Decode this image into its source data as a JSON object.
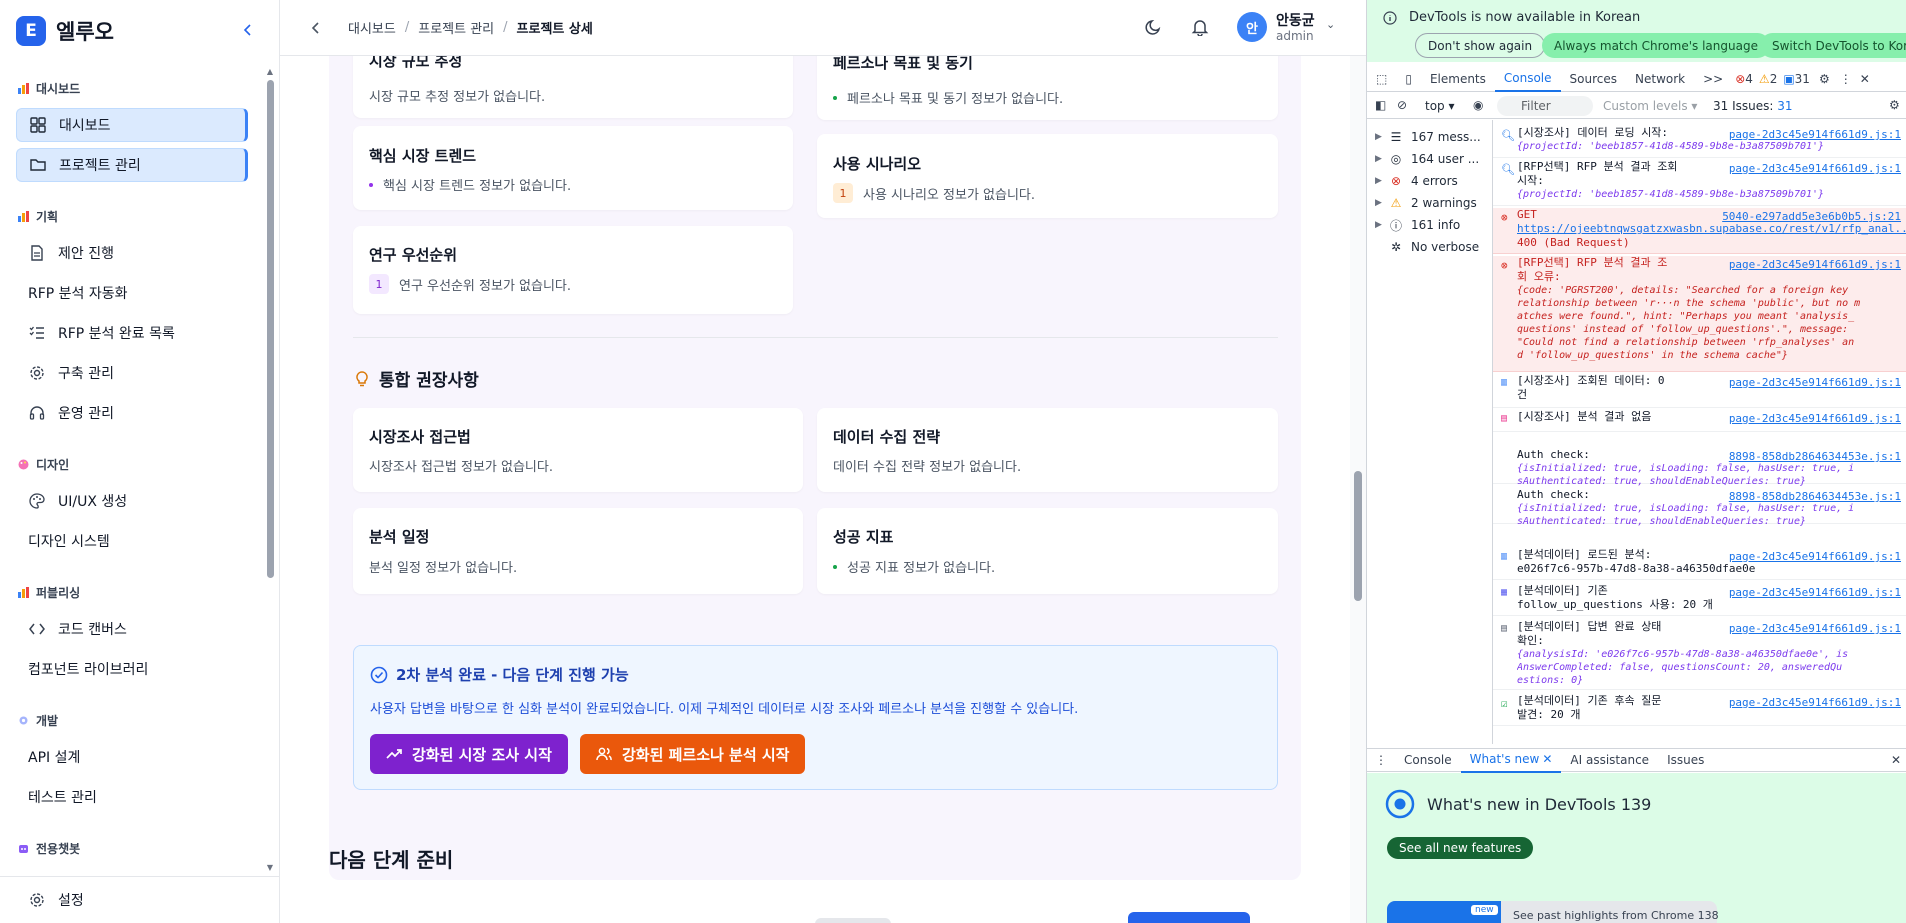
{
  "sidebar": {
    "logo_letter": "E",
    "app_name": "엘루오",
    "sections": [
      {
        "label": "대시보드"
      },
      {
        "label": "기획"
      },
      {
        "label": "디자인"
      },
      {
        "label": "퍼블리싱"
      },
      {
        "label": "개발"
      },
      {
        "label": "전용챗봇"
      }
    ],
    "items": [
      {
        "label": "대시보드",
        "icon": "grid-icon"
      },
      {
        "label": "프로젝트 관리",
        "icon": "folder-icon"
      },
      {
        "label": "제안 진행",
        "icon": "document-icon"
      },
      {
        "label": "RFP 분석 자동화",
        "icon": ""
      },
      {
        "label": "RFP 분석 완료 목록",
        "icon": "list-check-icon"
      },
      {
        "label": "구축 관리",
        "icon": "gear-icon"
      },
      {
        "label": "운영 관리",
        "icon": "headset-icon"
      },
      {
        "label": "UI/UX 생성",
        "icon": "palette-icon"
      },
      {
        "label": "디자인 시스템",
        "icon": ""
      },
      {
        "label": "코드 캔버스",
        "icon": "code-icon"
      },
      {
        "label": "컴포넌트 라이브러리",
        "icon": ""
      },
      {
        "label": "API 설계",
        "icon": ""
      },
      {
        "label": "테스트 관리",
        "icon": ""
      }
    ],
    "settings_label": "설정"
  },
  "header": {
    "breadcrumb": [
      "대시보드",
      "프로젝트 관리",
      "프로젝트 상세"
    ],
    "user_initial": "안",
    "user_name": "안동균",
    "user_role": "admin"
  },
  "cards": {
    "market_size": {
      "title": "시장 규모 추정",
      "body": "시장 규모 추정 정보가 없습니다."
    },
    "persona_goal": {
      "title": "페르소나 목표 및 동기",
      "body": "페르소나 목표 및 동기 정보가 없습니다."
    },
    "trend": {
      "title": "핵심 시장 트렌드",
      "body": "핵심 시장 트렌드 정보가 없습니다."
    },
    "scenario": {
      "title": "사용 시나리오",
      "number": "1",
      "body": "사용 시나리오 정보가 없습니다."
    },
    "priority": {
      "title": "연구 우선순위",
      "number": "1",
      "body": "연구 우선순위 정보가 없습니다."
    }
  },
  "recommend": {
    "title": "통합 권장사항",
    "approach": {
      "title": "시장조사 접근법",
      "body": "시장조사 접근법 정보가 없습니다."
    },
    "data_strategy": {
      "title": "데이터 수집 전략",
      "body": "데이터 수집 전략 정보가 없습니다."
    },
    "schedule": {
      "title": "분석 일정",
      "body": "분석 일정 정보가 없습니다."
    },
    "success": {
      "title": "성공 지표",
      "body": "성공 지표 정보가 없습니다."
    }
  },
  "completion": {
    "title": "2차 분석 완료 - 다음 단계 진행 가능",
    "description": "사용자 답변을 바탕으로 한 심화 분석이 완료되었습니다. 이제 구체적인 데이터로 시장 조사와 페르소나 분석을 진행할 수 있습니다.",
    "market_button": "강화된 시장 조사 시작",
    "persona_button": "강화된 페르소나 분석 시작",
    "market_color": "#7e22ce",
    "persona_color": "#ea580c"
  },
  "next_section_title": "다음 단계 준비",
  "devtools": {
    "notice": "DevTools is now available in Korean",
    "btn_dont_show": "Don't show again",
    "btn_match": "Always match Chrome's language",
    "btn_switch": "Switch DevTools to Korea",
    "tabs": [
      "Elements",
      "Console",
      "Sources",
      "Network"
    ],
    "more_tabs": ">>",
    "error_count": "4",
    "warning_count": "2",
    "issue_count": "31",
    "context": "top",
    "filter_placeholder": "Filter",
    "levels": "Custom levels",
    "issues_label": "31 Issues:",
    "issues_badge": "31",
    "side": [
      {
        "label": "167 mess..."
      },
      {
        "label": "164 user ..."
      },
      {
        "label": "4 errors"
      },
      {
        "label": "2 warnings"
      },
      {
        "label": "161 info"
      },
      {
        "label": "No verbose"
      }
    ],
    "logs": [
      {
        "text": "[시장조사] 데이터 로딩 시작:",
        "src": "page-2d3c45e914f661d9.js:1",
        "obj": "{projectId: 'beeb1857-41d8-4589-9b8e-b3a87509b701'}"
      },
      {
        "text": "[RFP선택] RFP 분석 결과 조회",
        "text2": "시작:",
        "src": "page-2d3c45e914f661d9.js:1",
        "obj": "{projectId: 'beeb1857-41d8-4589-9b8e-b3a87509b701'}"
      },
      {
        "text": "GET",
        "src": "5040-e297add5e3e6b0b5.js:21",
        "text2": "https://ojeebtnqwsgatzxwasbn.supabase.co/rest/v1/rfp_anal...",
        "text3": "400 (Bad Request)"
      },
      {
        "text": "[RFP선택] RFP 분석 결과 조",
        "text2": "회 오류:",
        "src": "page-2d3c45e914f661d9.js:1",
        "obj": "{code: 'PGRST200', details: \"Searched for a foreign key",
        "obj2": "relationship between 'r···n the schema 'public', but no m",
        "obj3": "atches were found.\", hint: \"Perhaps you meant 'analysis_",
        "obj4": "questions' instead of 'follow_up_questions'.\", message:",
        "obj5": "\"Could not find a relationship between 'rfp_analyses' an",
        "obj6": "d 'follow_up_questions' in the schema cache\"}"
      },
      {
        "text": "[시장조사] 조회된 데이터: 0",
        "text2": "건",
        "src": "page-2d3c45e914f661d9.js:1"
      },
      {
        "text": "[시장조사] 분석 결과 없음",
        "src": "page-2d3c45e914f661d9.js:1"
      },
      {
        "text": "Auth check:",
        "src": "8898-858db2864634453e.js:1",
        "obj": "{isInitialized: true, isLoading: false, hasUser: true, i",
        "obj2": "sAuthenticated: true, shouldEnableQueries: true}"
      },
      {
        "text": "Auth check:",
        "src": "8898-858db2864634453e.js:1",
        "obj": "{isInitialized: true, isLoading: false, hasUser: true, i",
        "obj2": "sAuthenticated: true, shouldEnableQueries: true}"
      },
      {
        "text": "[분석데이터] 로드된 분석:",
        "text2": "e026f7c6-957b-47d8-8a38-a46350dfae0e",
        "src": "page-2d3c45e914f661d9.js:1"
      },
      {
        "text": "[분석데이터] 기존",
        "text2": "follow_up_questions 사용: 20 개",
        "src": "page-2d3c45e914f661d9.js:1"
      },
      {
        "text": "[분석데이터] 답변 완료 상태",
        "text2": "확인:",
        "src": "page-2d3c45e914f661d9.js:1",
        "obj": "{analysisId: 'e026f7c6-957b-47d8-8a38-a46350dfae0e', is",
        "obj2": "AnswerCompleted: false, questionsCount: 20, answeredQu",
        "obj3": "estions: 0}"
      },
      {
        "text": "[분석데이터] 기존 후속 질문",
        "text2": "발견: 20 개",
        "src": "page-2d3c45e914f661d9.js:1"
      }
    ],
    "drawer_tabs": [
      "Console",
      "What's new",
      "AI assistance",
      "Issues"
    ],
    "whatsnew_title": "What's new in DevTools 139",
    "whatsnew_button": "See all new features",
    "whatsnew_badge": "new",
    "whatsnew_item": "See past highlights from Chrome 138"
  },
  "colors": {
    "accent": "#2563eb",
    "error": "#d93025",
    "warning": "#f29900",
    "success": "#16a34a"
  }
}
